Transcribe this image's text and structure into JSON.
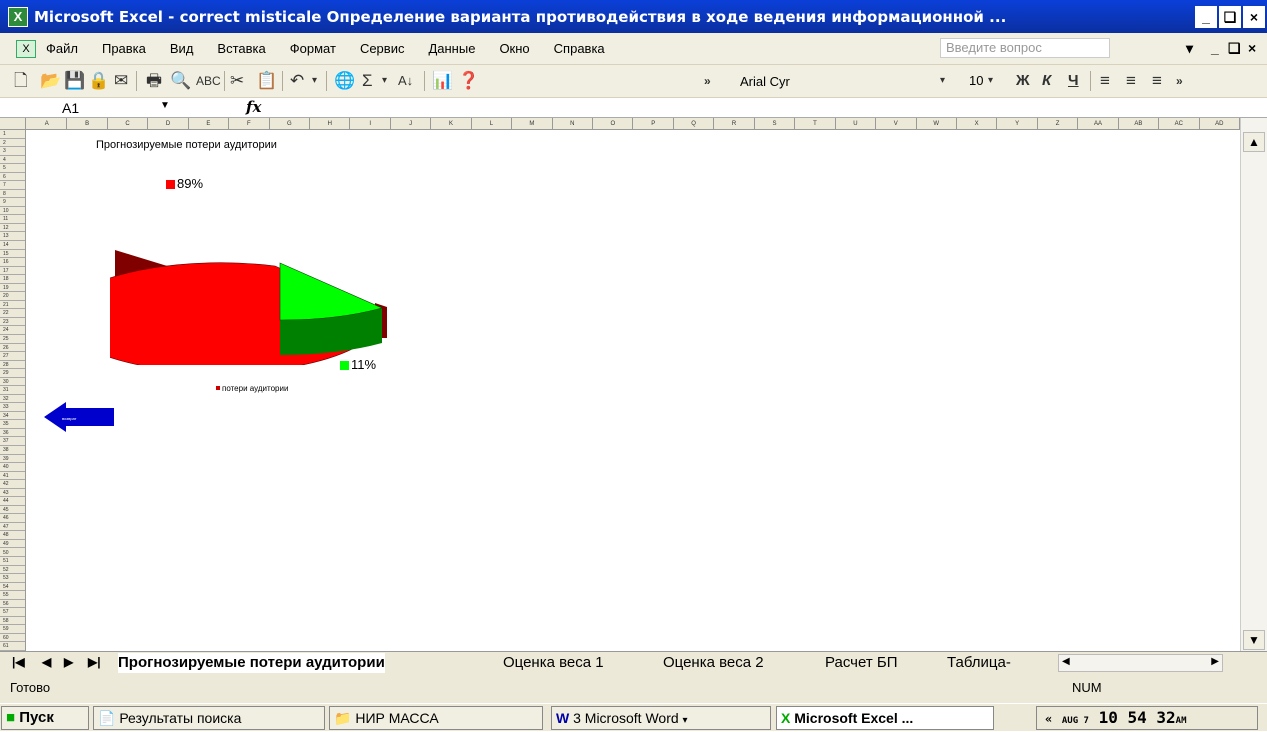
{
  "window": {
    "title": "Microsoft Excel - correct misticale Определение варианта противодействия в ходе ведения информационной ...",
    "minimize": "_",
    "restore": "Е",
    "close": "×"
  },
  "menu": {
    "items": [
      "Файл",
      "Правка",
      "Вид",
      "Вставка",
      "Формат",
      "Сервис",
      "Данные",
      "Окно",
      "Справка"
    ],
    "ask_placeholder": "Введите вопрос"
  },
  "toolbar": {
    "font": "Arial Cyr",
    "size": "10",
    "bold": "Ж",
    "italic": "К",
    "underline": "Ч"
  },
  "formula_bar": {
    "cell_ref": "A1",
    "fx": "fx"
  },
  "columns": [
    "A",
    "B",
    "C",
    "D",
    "E",
    "F",
    "G",
    "H",
    "I",
    "J",
    "K",
    "L",
    "M",
    "N",
    "O",
    "P",
    "Q",
    "R",
    "S",
    "T",
    "U",
    "V",
    "W",
    "X",
    "Y",
    "Z",
    "AA",
    "AB",
    "AC",
    "AD"
  ],
  "rows_count": 61,
  "chart_data": {
    "type": "pie",
    "title": "Прогнозируемые потери аудитории",
    "slices": [
      {
        "label": "89%",
        "value": 89,
        "color": "#ff0000"
      },
      {
        "label": "11%",
        "value": 11,
        "color": "#00ff00"
      }
    ],
    "legend": [
      "потери аудитории"
    ],
    "style": "3d-exploded"
  },
  "back_button_label": "возврат",
  "sheet_tabs": {
    "items": [
      "Прогнозируемые потери аудитории",
      "Оценка веса 1",
      "Оценка веса 2",
      "Расчет БП",
      "Таблица-"
    ],
    "active": 0
  },
  "status": {
    "text": "Готово",
    "num": "NUM"
  },
  "taskbar": {
    "start": "Пуск",
    "tasks": [
      "Результаты поиска",
      "НИР МАССА",
      "3 Microsoft Word",
      "Microsoft Excel ..."
    ],
    "clock": "10 54 32",
    "clock_date": "AUG 7",
    "clock_ampm": "AM"
  }
}
